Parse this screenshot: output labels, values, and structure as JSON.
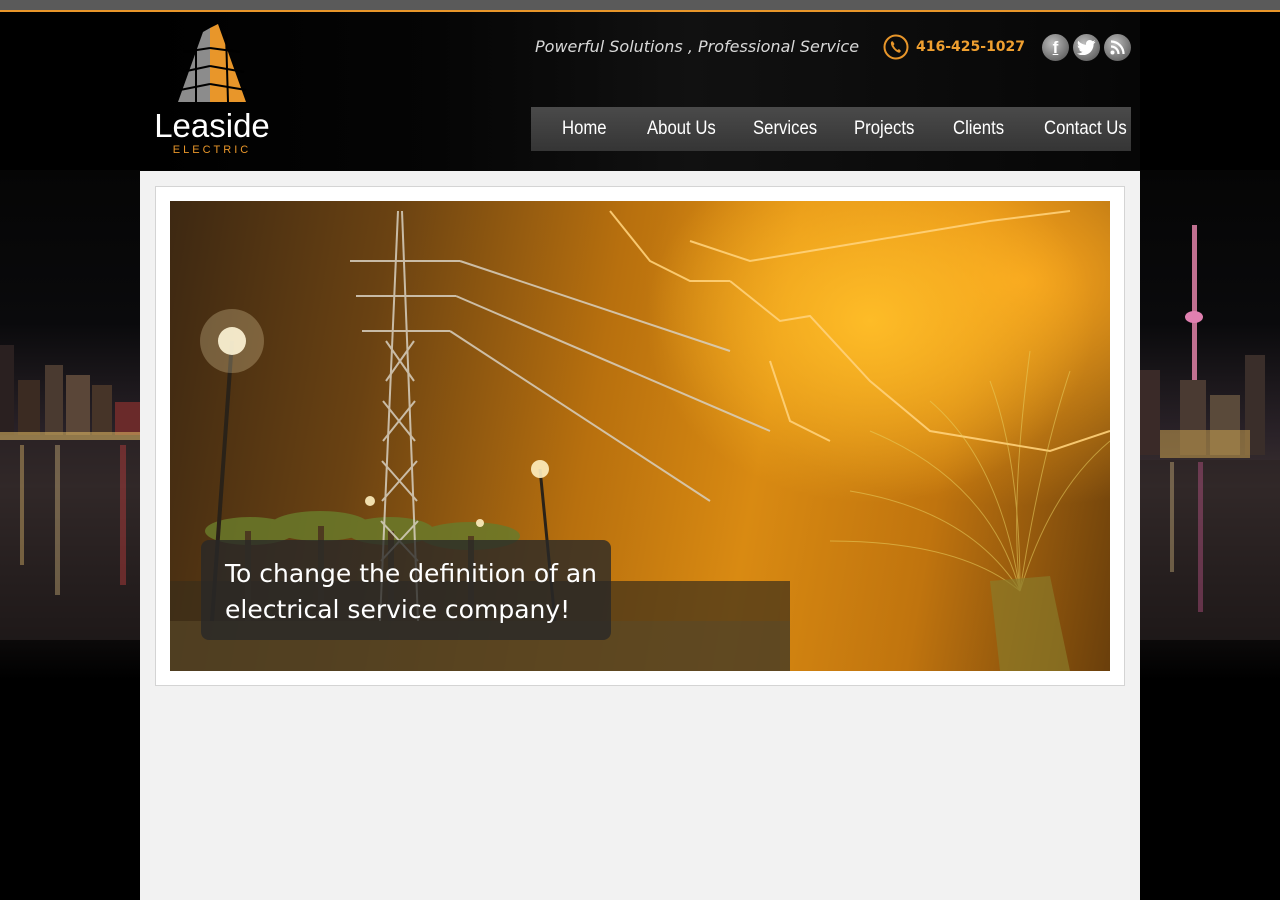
{
  "brand": {
    "name": "Leaside",
    "subtitle": "ELECTRIC"
  },
  "header": {
    "tagline": "Powerful Solutions , Professional Service",
    "phone": "416-425-1027",
    "social": [
      {
        "icon": "facebook-icon",
        "label": "f"
      },
      {
        "icon": "twitter-icon",
        "label": "t"
      },
      {
        "icon": "rss-icon",
        "label": "rss"
      }
    ]
  },
  "nav": {
    "items": [
      "Home",
      "About Us",
      "Services",
      "Projects",
      "Clients",
      "Contact Us"
    ]
  },
  "hero": {
    "caption": "To change the definition of an electrical service company!"
  },
  "colors": {
    "accent": "#e8962a",
    "nav_bg": "#3f3f3f",
    "content_bg": "#f2f2f2"
  }
}
